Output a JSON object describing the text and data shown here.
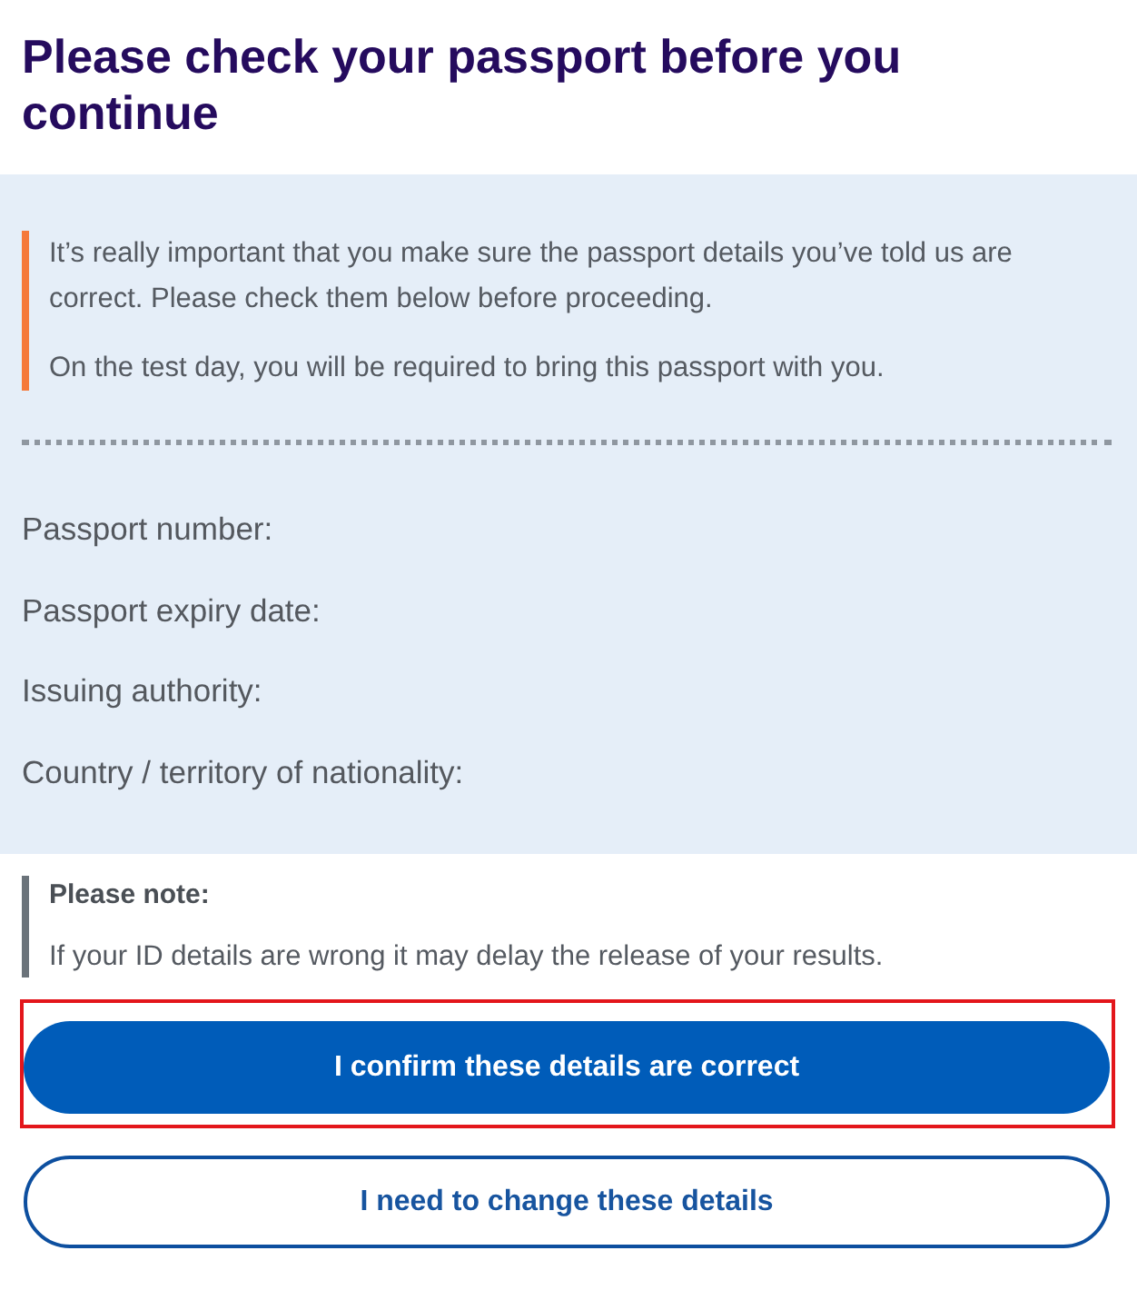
{
  "title": "Please check your passport before you continue",
  "notice": {
    "paragraphs": [
      "It’s really important that you make sure the passport details you’ve told us are correct. Please check them below before proceeding.",
      "On the test day, you will be required to bring this passport with you."
    ]
  },
  "fields": [
    {
      "label": "Passport number:"
    },
    {
      "label": "Passport expiry date:"
    },
    {
      "label": "Issuing authority:"
    },
    {
      "label": "Country / territory of nationality:"
    }
  ],
  "note": {
    "heading": "Please note:",
    "text": "If your ID details are wrong it may delay the release of your results."
  },
  "buttons": [
    {
      "label": "I confirm these details are correct",
      "kind": "primary",
      "highlighted": true
    },
    {
      "label": "I need to change these details",
      "kind": "secondary",
      "highlighted": false
    }
  ]
}
